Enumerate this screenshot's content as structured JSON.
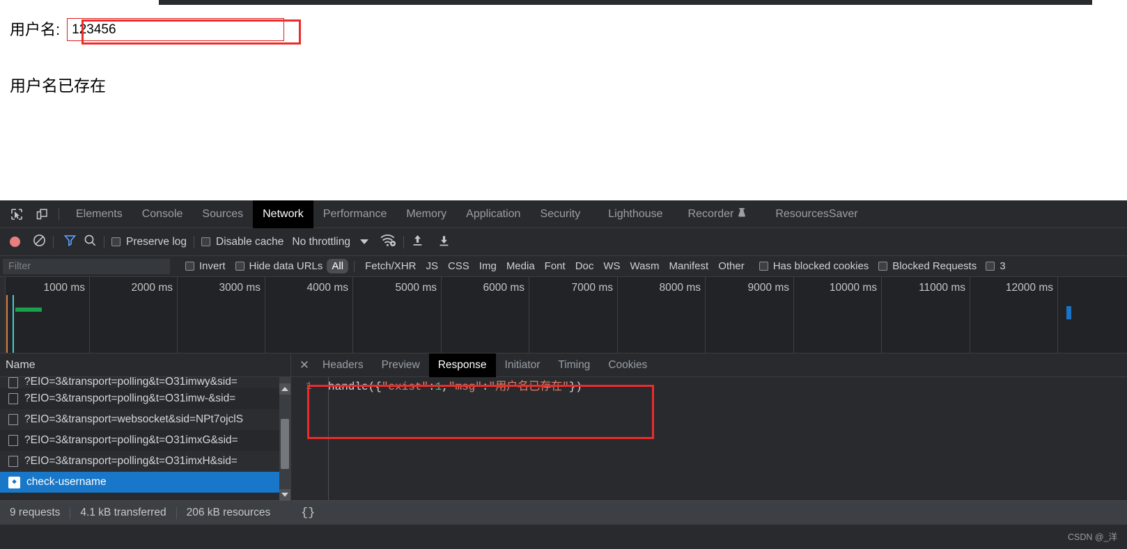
{
  "page": {
    "username_label": "用户名:",
    "username_value": "123456",
    "username_placeholder": "",
    "result_message": "用户名已存在"
  },
  "devtools": {
    "main_tabs": [
      {
        "label": "Elements",
        "active": false
      },
      {
        "label": "Console",
        "active": false
      },
      {
        "label": "Sources",
        "active": false
      },
      {
        "label": "Network",
        "active": true
      },
      {
        "label": "Performance",
        "active": false
      },
      {
        "label": "Memory",
        "active": false
      },
      {
        "label": "Application",
        "active": false
      },
      {
        "label": "Security",
        "active": false
      },
      {
        "label": "Lighthouse",
        "active": false
      },
      {
        "label": "Recorder",
        "active": false,
        "badge": "flask-icon"
      },
      {
        "label": "ResourcesSaver",
        "active": false
      }
    ],
    "toolbar": {
      "record_icon": "record-dot-icon",
      "clear_icon": "clear-icon",
      "filter_icon": "funnel-icon",
      "search_icon": "search-icon",
      "preserve_log_label": "Preserve log",
      "preserve_log_checked": false,
      "disable_cache_label": "Disable cache",
      "disable_cache_checked": false,
      "throttling_value": "No throttling",
      "network_conditions_icon": "wifi-gear-icon",
      "import_har_icon": "upload-arrow-icon",
      "export_har_icon": "download-arrow-icon"
    },
    "filter_row": {
      "filter_placeholder": "Filter",
      "filter_value": "",
      "invert_label": "Invert",
      "invert_checked": false,
      "hide_data_urls_label": "Hide data URLs",
      "hide_data_urls_checked": false,
      "type_filters": [
        {
          "label": "All",
          "active": true
        },
        {
          "label": "Fetch/XHR",
          "active": false
        },
        {
          "label": "JS",
          "active": false
        },
        {
          "label": "CSS",
          "active": false
        },
        {
          "label": "Img",
          "active": false
        },
        {
          "label": "Media",
          "active": false
        },
        {
          "label": "Font",
          "active": false
        },
        {
          "label": "Doc",
          "active": false
        },
        {
          "label": "WS",
          "active": false
        },
        {
          "label": "Wasm",
          "active": false
        },
        {
          "label": "Manifest",
          "active": false
        },
        {
          "label": "Other",
          "active": false
        }
      ],
      "has_blocked_cookies_label": "Has blocked cookies",
      "has_blocked_cookies_checked": false,
      "blocked_requests_label": "Blocked Requests",
      "blocked_requests_checked": false,
      "third_party_label": "3"
    },
    "overview": {
      "ticks": [
        "1000 ms",
        "2000 ms",
        "3000 ms",
        "4000 ms",
        "5000 ms",
        "6000 ms",
        "7000 ms",
        "8000 ms",
        "9000 ms",
        "10000 ms",
        "11000 ms",
        "12000 ms"
      ],
      "marker_dcl_color": "#3fd0cf",
      "marker_load_color": "#d8814a",
      "activity_bar_color": "#18a04a",
      "late_request_color": "#1a73c8"
    },
    "request_panel": {
      "column_header": "Name",
      "rows": [
        {
          "name": "?EIO=3&transport=polling&t=O31imwy&sid=",
          "icon": "document-icon",
          "selected": false,
          "clipped": true
        },
        {
          "name": "?EIO=3&transport=polling&t=O31imw-&sid=",
          "icon": "document-icon",
          "selected": false,
          "clipped": false
        },
        {
          "name": "?EIO=3&transport=websocket&sid=NPt7ojclS",
          "icon": "document-icon",
          "selected": false,
          "clipped": false
        },
        {
          "name": "?EIO=3&transport=polling&t=O31imxG&sid=",
          "icon": "document-icon",
          "selected": false,
          "clipped": false
        },
        {
          "name": "?EIO=3&transport=polling&t=O31imxH&sid=",
          "icon": "document-icon",
          "selected": false,
          "clipped": false
        },
        {
          "name": "check-username",
          "icon": "script-icon",
          "selected": true,
          "clipped": false
        }
      ],
      "status": {
        "requests": "9 requests",
        "transferred": "4.1 kB transferred",
        "resources": "206 kB resources"
      },
      "scrollbar": {
        "up_arrow_icon": "triangle-up-icon",
        "down_arrow_icon": "triangle-down-icon"
      }
    },
    "detail_panel": {
      "close_icon": "close-icon",
      "tabs": [
        {
          "label": "Headers",
          "active": false
        },
        {
          "label": "Preview",
          "active": false
        },
        {
          "label": "Response",
          "active": true
        },
        {
          "label": "Initiator",
          "active": false
        },
        {
          "label": "Timing",
          "active": false
        },
        {
          "label": "Cookies",
          "active": false
        }
      ],
      "response": {
        "line_number": "1",
        "tokens": [
          {
            "text": "handle({",
            "kind": "plain"
          },
          {
            "text": "\"exist\"",
            "kind": "string"
          },
          {
            "text": ":",
            "kind": "plain"
          },
          {
            "text": "1",
            "kind": "number"
          },
          {
            "text": ",",
            "kind": "plain"
          },
          {
            "text": "\"msg\"",
            "kind": "string"
          },
          {
            "text": ":",
            "kind": "plain"
          },
          {
            "text": "\"用户名已存在\"",
            "kind": "string"
          },
          {
            "text": "})",
            "kind": "plain"
          }
        ],
        "raw": "handle({\"exist\":1,\"msg\":\"用户名已存在\"})"
      },
      "pretty_print_label": "{}"
    },
    "watermark": "CSDN @_洋"
  },
  "colors": {
    "accent_selection": "#1877c9",
    "annotation_red": "#ee2b2b",
    "string_token": "#e8836a",
    "number_token": "#4ec08a",
    "panel_bg": "#282a2e",
    "tab_active_bg": "#000000"
  }
}
